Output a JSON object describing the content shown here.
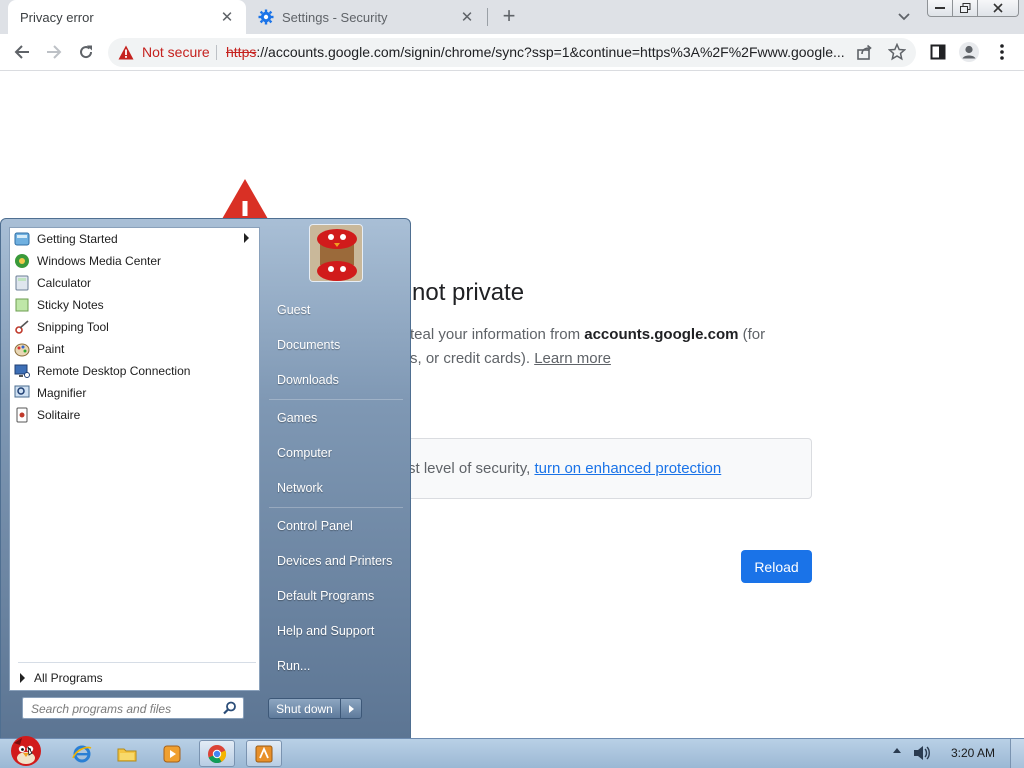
{
  "browser": {
    "tabs": [
      {
        "title": "Privacy error",
        "active": true
      },
      {
        "title": "Settings - Security",
        "active": false
      }
    ],
    "omnibox": {
      "security_label": "Not secure",
      "url_scheme": "https",
      "url_rest": "://accounts.google.com/signin/chrome/sync?ssp=1&continue=https%3A%2F%2Fwww.google..."
    }
  },
  "page": {
    "heading": "not private",
    "desc_line1_prefix": "teal your information from ",
    "desc_domain": "accounts.google.com",
    "desc_line1_suffix": " (for",
    "desc_line2_prefix": "s, or credit cards). ",
    "learn_more": "Learn more",
    "enhanced_prefix": "st level of security, ",
    "enhanced_link": "turn on enhanced protection",
    "reload_label": "Reload"
  },
  "start_menu": {
    "programs": [
      {
        "label": "Getting Started",
        "icon": "getting-started-icon",
        "has_submenu": true
      },
      {
        "label": "Windows Media Center",
        "icon": "media-center-icon"
      },
      {
        "label": "Calculator",
        "icon": "calculator-icon"
      },
      {
        "label": "Sticky Notes",
        "icon": "sticky-notes-icon"
      },
      {
        "label": "Snipping Tool",
        "icon": "snipping-tool-icon"
      },
      {
        "label": "Paint",
        "icon": "paint-icon"
      },
      {
        "label": "Remote Desktop Connection",
        "icon": "remote-desktop-icon"
      },
      {
        "label": "Magnifier",
        "icon": "magnifier-icon"
      },
      {
        "label": "Solitaire",
        "icon": "solitaire-icon"
      }
    ],
    "all_programs": "All Programs",
    "search_placeholder": "Search programs and files",
    "places": [
      {
        "label": "Guest"
      },
      {
        "label": "Documents"
      },
      {
        "label": "Downloads"
      },
      {
        "label": "Games"
      },
      {
        "label": "Computer"
      },
      {
        "label": "Network"
      },
      {
        "label": "Control Panel"
      },
      {
        "label": "Devices and Printers"
      },
      {
        "label": "Default Programs"
      },
      {
        "label": "Help and Support"
      },
      {
        "label": "Run..."
      }
    ],
    "shutdown_label": "Shut down"
  },
  "taskbar": {
    "apps": [
      "internet-explorer-icon",
      "explorer-folder-icon",
      "media-player-icon",
      "chrome-icon",
      "app-icon"
    ],
    "clock": "3:20 AM"
  },
  "colors": {
    "warning_red": "#c5221f",
    "link_blue": "#1a73e8",
    "start_menu_blue": "#7f98b4"
  }
}
